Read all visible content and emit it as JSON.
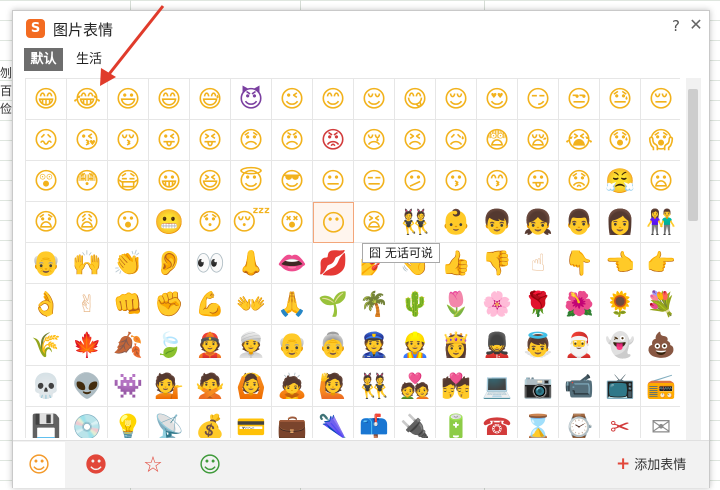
{
  "window": {
    "title": "图片表情",
    "logo_letter": "S",
    "help_label": "?",
    "close_label": "✕"
  },
  "tabs": [
    {
      "label": "默认",
      "active": true
    },
    {
      "label": "生活",
      "active": false
    }
  ],
  "tooltip": {
    "text": "囧 无话可说"
  },
  "emoji_rows": [
    [
      [
        "😁",
        "face"
      ],
      [
        "😂",
        "face"
      ],
      [
        "😃",
        "face"
      ],
      [
        "😄",
        "face"
      ],
      [
        "😅",
        "face"
      ],
      [
        "😈",
        "devil"
      ],
      [
        "😉",
        "face"
      ],
      [
        "😊",
        "face"
      ],
      [
        "😌",
        "face"
      ],
      [
        "😋",
        "face"
      ],
      [
        "😌",
        "face"
      ],
      [
        "😍",
        "face"
      ],
      [
        "😏",
        "face"
      ],
      [
        "😒",
        "face"
      ],
      [
        "😓",
        "face"
      ],
      [
        "😔",
        "face"
      ]
    ],
    [
      [
        "😖",
        "face"
      ],
      [
        "😘",
        "face"
      ],
      [
        "😚",
        "face"
      ],
      [
        "😜",
        "face"
      ],
      [
        "😝",
        "face"
      ],
      [
        "😞",
        "face"
      ],
      [
        "😠",
        "face"
      ],
      [
        "😡",
        "red"
      ],
      [
        "😢",
        "face"
      ],
      [
        "😣",
        "face"
      ],
      [
        "😥",
        "face"
      ],
      [
        "😨",
        "face"
      ],
      [
        "😪",
        "face"
      ],
      [
        "😭",
        "face"
      ],
      [
        "😰",
        "face"
      ],
      [
        "😱",
        "face"
      ]
    ],
    [
      [
        "😲",
        "face"
      ],
      [
        "😳",
        "face"
      ],
      [
        "😷",
        "face"
      ],
      [
        "😀",
        "face"
      ],
      [
        "😆",
        "face"
      ],
      [
        "😇",
        "face"
      ],
      [
        "😎",
        "face"
      ],
      [
        "😐",
        "face"
      ],
      [
        "😑",
        "face"
      ],
      [
        "😕",
        "face"
      ],
      [
        "😗",
        "face"
      ],
      [
        "😙",
        "face"
      ],
      [
        "😛",
        "face"
      ],
      [
        "😟",
        "face"
      ],
      [
        "😤",
        "face"
      ],
      [
        "😦",
        "face"
      ]
    ],
    [
      [
        "😧",
        "face"
      ],
      [
        "😩",
        "face"
      ],
      [
        "😮",
        "face"
      ],
      [
        "😬",
        "face"
      ],
      [
        "😯",
        "face"
      ],
      [
        "😴",
        "face"
      ],
      [
        "😵",
        "face"
      ],
      [
        "😶",
        "face"
      ],
      [
        "😫",
        "face"
      ],
      [
        "👯",
        "dark"
      ],
      [
        "👶",
        "skin"
      ],
      [
        "👦",
        "skin"
      ],
      [
        "👧",
        "dark"
      ],
      [
        "👨",
        "dark"
      ],
      [
        "👩",
        "dark"
      ],
      [
        "👫",
        "blue"
      ]
    ],
    [
      [
        "👴",
        "skin"
      ],
      [
        "🙌",
        "skin"
      ],
      [
        "👏",
        "skin"
      ],
      [
        "👂",
        "skin"
      ],
      [
        "👀",
        "dark"
      ],
      [
        "👃",
        "skin"
      ],
      [
        "👄",
        "red"
      ],
      [
        "💋",
        "red"
      ],
      [
        "💅",
        "skin"
      ],
      [
        "👋",
        "skin"
      ],
      [
        "👍",
        "skin"
      ],
      [
        "👎",
        "skin"
      ],
      [
        "☝",
        "skin"
      ],
      [
        "👇",
        "skin"
      ],
      [
        "👈",
        "skin"
      ],
      [
        "👉",
        "skin"
      ]
    ],
    [
      [
        "👌",
        "skin"
      ],
      [
        "✌",
        "skin"
      ],
      [
        "👊",
        "skin"
      ],
      [
        "✊",
        "skin"
      ],
      [
        "💪",
        "skin"
      ],
      [
        "👐",
        "skin"
      ],
      [
        "🙏",
        "skin"
      ],
      [
        "🌱",
        "green"
      ],
      [
        "🌴",
        "green"
      ],
      [
        "🌵",
        "green"
      ],
      [
        "🌷",
        "pink"
      ],
      [
        "🌸",
        "pink"
      ],
      [
        "🌹",
        "red"
      ],
      [
        "🌺",
        "red"
      ],
      [
        "🌻",
        "face"
      ],
      [
        "💐",
        "pink"
      ]
    ],
    [
      [
        "🌾",
        "green"
      ],
      [
        "🍁",
        "red"
      ],
      [
        "🍂",
        "brown"
      ],
      [
        "🍃",
        "green"
      ],
      [
        "👲",
        "skin"
      ],
      [
        "👳",
        "skin"
      ],
      [
        "👴",
        "skin"
      ],
      [
        "👵",
        "skin"
      ],
      [
        "👮",
        "blue"
      ],
      [
        "👷",
        "face"
      ],
      [
        "👸",
        "skin"
      ],
      [
        "💂",
        "dark"
      ],
      [
        "👼",
        "skin"
      ],
      [
        "🎅",
        "red"
      ],
      [
        "👻",
        "gray"
      ],
      [
        "💩",
        "brown"
      ]
    ],
    [
      [
        "💀",
        "gray"
      ],
      [
        "👽",
        "gray"
      ],
      [
        "👾",
        "devil"
      ],
      [
        "💁",
        "skin"
      ],
      [
        "🙅",
        "pink"
      ],
      [
        "🙆",
        "pink"
      ],
      [
        "🙇",
        "skin"
      ],
      [
        "🙋",
        "skin"
      ],
      [
        "👯",
        "face"
      ],
      [
        "💑",
        "pink"
      ],
      [
        "💏",
        "face"
      ],
      [
        "💻",
        "gray"
      ],
      [
        "📷",
        "gray"
      ],
      [
        "📹",
        "gray"
      ],
      [
        "📺",
        "brown"
      ],
      [
        "📻",
        "brown"
      ]
    ],
    [
      [
        "💾",
        "gray"
      ],
      [
        "💿",
        "gray"
      ],
      [
        "💡",
        "face"
      ],
      [
        "📡",
        "gray"
      ],
      [
        "💰",
        "brown"
      ],
      [
        "💳",
        "face"
      ],
      [
        "💼",
        "brown"
      ],
      [
        "🌂",
        "pink"
      ],
      [
        "📫",
        "blue"
      ],
      [
        "🔌",
        "dark"
      ],
      [
        "🔋",
        "green"
      ],
      [
        "☎",
        "red"
      ],
      [
        "⌛",
        "brown"
      ],
      [
        "⌚",
        "dark"
      ],
      [
        "✂",
        "red"
      ],
      [
        "✉",
        "gray"
      ]
    ]
  ],
  "bottom_tabs": [
    {
      "icon": "smiley-icon",
      "glyph": "☺",
      "color": "#f39a2b"
    },
    {
      "icon": "fire-face-icon",
      "glyph": "☻",
      "color": "#e2473a"
    },
    {
      "icon": "star-icon",
      "glyph": "☆",
      "color": "#e2473a"
    },
    {
      "icon": "character-face-icon",
      "glyph": "☺",
      "color": "#3f9a3a"
    }
  ],
  "add_button": {
    "plus": "+",
    "label": "添加表情"
  },
  "background": {
    "text_lines": [
      "刎",
      "百",
      "俭"
    ]
  }
}
